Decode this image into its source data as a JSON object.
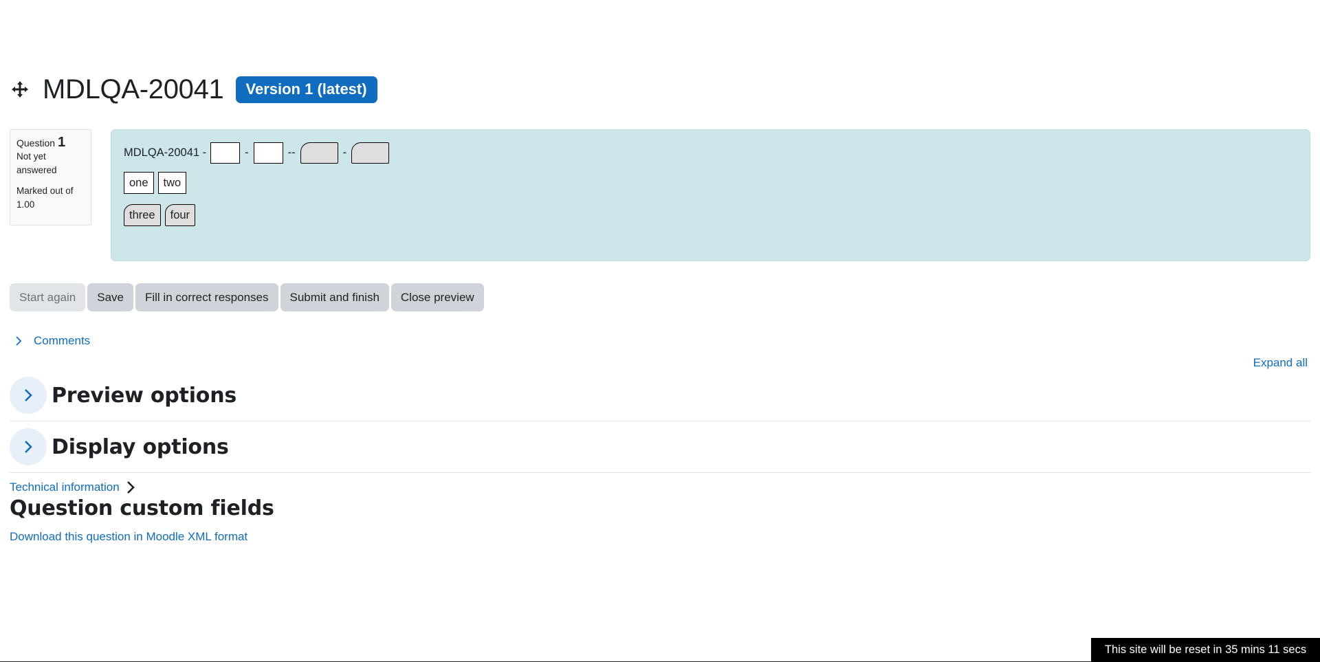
{
  "header": {
    "title": "MDLQA-20041",
    "version_badge": "Version 1 (latest)"
  },
  "question_info": {
    "label": "Question",
    "number": "1",
    "state_line1": "Not yet",
    "state_line2": "answered",
    "marks_line1": "Marked out of",
    "marks_line2": "1.00"
  },
  "question": {
    "prefix": "MDLQA-20041 -",
    "sep1": "-",
    "sep2": "--",
    "sep3": "-",
    "drag_items_row1": [
      "one",
      "two"
    ],
    "drag_items_row2": [
      "three",
      "four"
    ]
  },
  "buttons": {
    "start_again": "Start again",
    "save": "Save",
    "fill_correct": "Fill in correct responses",
    "submit_finish": "Submit and finish",
    "close_preview": "Close preview"
  },
  "comments_label": "Comments",
  "expand_all": "Expand all",
  "sections": {
    "preview_options": "Preview options",
    "display_options": "Display options"
  },
  "technical_information": "Technical information",
  "custom_fields_heading": "Question custom fields",
  "download_link": "Download this question in Moodle XML format",
  "reset_notice": "This site will be reset in 35 mins 11 secs",
  "colors": {
    "accent": "#0f6cbf",
    "question_bg": "#cce6ea",
    "button_bg": "#ced4da"
  }
}
